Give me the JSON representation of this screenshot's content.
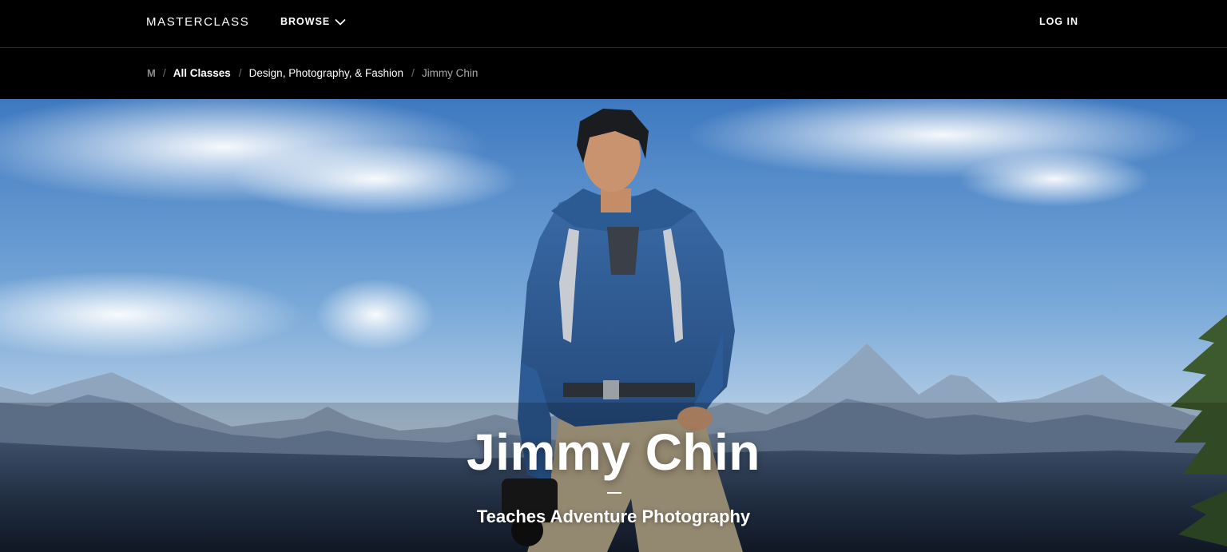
{
  "header": {
    "logo": "MASTERCLASS",
    "browse_label": "BROWSE",
    "login_label": "LOG IN"
  },
  "breadcrumb": {
    "home_icon": "M",
    "separator": "/",
    "items": [
      "All Classes",
      "Design, Photography, & Fashion",
      "Jimmy Chin"
    ]
  },
  "hero": {
    "name": "Jimmy Chin",
    "subtitle": "Teaches Adventure Photography"
  },
  "colors": {
    "background": "#000000",
    "text": "#ffffff",
    "breadcrumb_muted": "#a7a7a7",
    "sky": "#5f93cf",
    "jacket": "#2f5b93"
  },
  "icons": {
    "browse": "chevron-down-icon",
    "home": "masterclass-m-icon"
  }
}
